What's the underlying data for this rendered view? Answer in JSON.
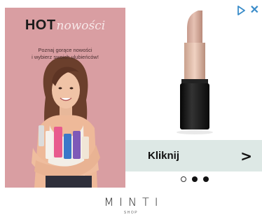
{
  "promo": {
    "headline_hot": "HOT",
    "headline_word": "nowości",
    "subtitle_line1": "Poznaj gorące nowości",
    "subtitle_line2": "i wybierz swoich ulubieńców!"
  },
  "cta": {
    "label": "Kliknij",
    "arrow": ">"
  },
  "carousel": {
    "slides": 3,
    "active_index": 0
  },
  "brand": {
    "name": "MINTI",
    "tagline": "SHOP"
  },
  "adchoices": {
    "close": "✕"
  },
  "colors": {
    "promo_bg": "#d99ea2",
    "cta_bg": "#dde8e5",
    "adchoices": "#3a8cc9"
  }
}
